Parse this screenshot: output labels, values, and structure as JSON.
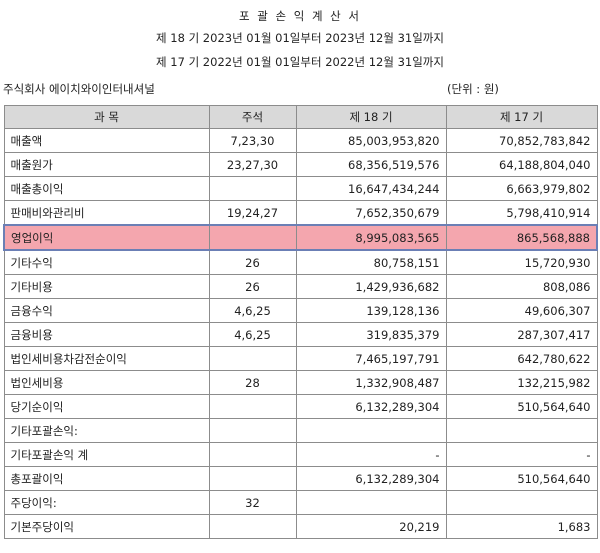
{
  "header": {
    "title": "포 괄 손 익 계 산 서",
    "period_current": "제 18 기 2023년 01월 01일부터 2023년 12월 31일까지",
    "period_prior": "제 17 기 2022년 01월 01일부터 2022년 12월 31일까지",
    "company": "주식회사 에이치와이인터내셔널",
    "unit": "(단위 : 원)"
  },
  "table": {
    "columns": [
      "과  목",
      "주석",
      "제 18 기",
      "제 17 기"
    ],
    "rows": [
      {
        "item": "매출액",
        "note": "7,23,30",
        "cur": "85,003,953,820",
        "prior": "70,852,783,842"
      },
      {
        "item": "매출원가",
        "note": "23,27,30",
        "cur": "68,356,519,576",
        "prior": "64,188,804,040"
      },
      {
        "item": "매출총이익",
        "note": "",
        "cur": "16,647,434,244",
        "prior": "6,663,979,802"
      },
      {
        "item": "판매비와관리비",
        "note": "19,24,27",
        "cur": "7,652,350,679",
        "prior": "5,798,410,914"
      },
      {
        "item": "영업이익",
        "note": "",
        "cur": "8,995,083,565",
        "prior": "865,568,888"
      },
      {
        "item": "기타수익",
        "note": "26",
        "cur": "80,758,151",
        "prior": "15,720,930"
      },
      {
        "item": "기타비용",
        "note": "26",
        "cur": "1,429,936,682",
        "prior": "808,086"
      },
      {
        "item": "금융수익",
        "note": "4,6,25",
        "cur": "139,128,136",
        "prior": "49,606,307"
      },
      {
        "item": "금융비용",
        "note": "4,6,25",
        "cur": "319,835,379",
        "prior": "287,307,417"
      },
      {
        "item": "법인세비용차감전순이익",
        "note": "",
        "cur": "7,465,197,791",
        "prior": "642,780,622"
      },
      {
        "item": "법인세비용",
        "note": "28",
        "cur": "1,332,908,487",
        "prior": "132,215,982"
      },
      {
        "item": "당기순이익",
        "note": "",
        "cur": "6,132,289,304",
        "prior": "510,564,640"
      },
      {
        "item": "기타포괄손익:",
        "note": "",
        "cur": "",
        "prior": ""
      },
      {
        "item": "기타포괄손익 계",
        "note": "",
        "cur": "-",
        "prior": "-"
      },
      {
        "item": "총포괄이익",
        "note": "",
        "cur": "6,132,289,304",
        "prior": "510,564,640"
      },
      {
        "item": "주당이익:",
        "note": "32",
        "cur": "",
        "prior": ""
      },
      {
        "item": "기본주당이익",
        "note": "",
        "cur": "20,219",
        "prior": "1,683"
      }
    ]
  }
}
